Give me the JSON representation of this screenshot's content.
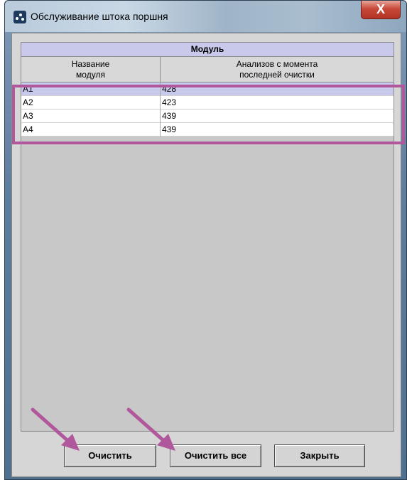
{
  "window": {
    "title": "Обслуживание штока поршня",
    "close_glyph": "X"
  },
  "table": {
    "group_header": "Модуль",
    "columns": [
      {
        "line1": "Название",
        "line2": "модуля"
      },
      {
        "line1": "Анализов с момента",
        "line2": "последней очистки"
      }
    ],
    "rows": [
      {
        "module": "A1",
        "count": "428",
        "selected": true
      },
      {
        "module": "A2",
        "count": "423",
        "selected": false
      },
      {
        "module": "A3",
        "count": "439",
        "selected": false
      },
      {
        "module": "A4",
        "count": "439",
        "selected": false
      }
    ]
  },
  "buttons": {
    "clear": "Очистить",
    "clear_all": "Очистить все",
    "close": "Закрыть"
  },
  "annotations": {
    "highlight_color": "#b0589b",
    "arrow_color": "#b0589b"
  }
}
